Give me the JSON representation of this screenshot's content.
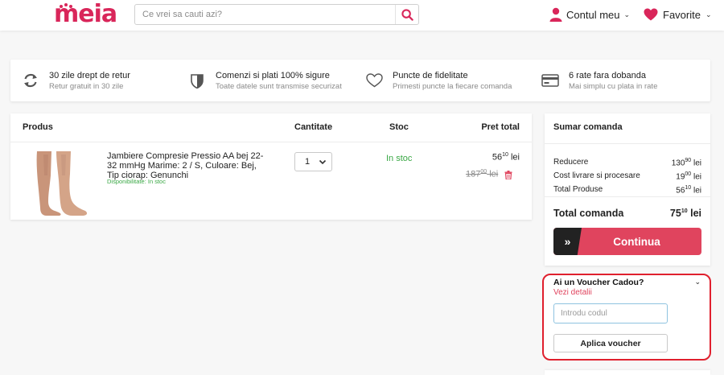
{
  "header": {
    "logo": "meia",
    "search_placeholder": "Ce vrei sa cauti azi?",
    "account_label": "Contul meu",
    "favorites_label": "Favorite"
  },
  "features": [
    {
      "icon": "refresh-icon",
      "title": "30 zile drept de retur",
      "subtitle": "Retur gratuit in 30 zile"
    },
    {
      "icon": "shield-icon",
      "title": "Comenzi si plati 100% sigure",
      "subtitle": "Toate datele sunt transmise securizat"
    },
    {
      "icon": "heart-outline-icon",
      "title": "Puncte de fidelitate",
      "subtitle": "Primesti puncte la fiecare comanda"
    },
    {
      "icon": "credit-card-icon",
      "title": "6 rate fara dobanda",
      "subtitle": "Mai simplu cu plata in rate"
    }
  ],
  "cart": {
    "headers": {
      "product": "Produs",
      "quantity": "Cantitate",
      "stock": "Stoc",
      "total": "Pret total"
    },
    "item": {
      "name": "Jambiere Compresie Pressio AA bej 22-32 mmHg Marime: 2 / S, Culoare: Bej, Tip ciorap: Genunchi",
      "availability": "Disponibilitate: In stoc",
      "quantity": "1",
      "stock": "In stoc",
      "price_int": "56",
      "price_dec": "10",
      "old_price_int": "187",
      "old_price_dec": "00",
      "currency": "lei"
    }
  },
  "summary": {
    "title": "Sumar comanda",
    "rows": [
      {
        "label": "Reducere",
        "int": "130",
        "dec": "90",
        "currency": "lei"
      },
      {
        "label": "Cost livrare si procesare",
        "int": "19",
        "dec": "00",
        "currency": "lei"
      },
      {
        "label": "Total Produse",
        "int": "56",
        "dec": "10",
        "currency": "lei"
      }
    ],
    "total_label": "Total comanda",
    "total_int": "75",
    "total_dec": "10",
    "total_currency": "lei",
    "continue_label": "Continua",
    "continue_arrow": "»"
  },
  "voucher": {
    "title": "Ai un Voucher Cadou?",
    "details_link": "Vezi detalii",
    "input_placeholder": "Introdu codul",
    "apply_label": "Aplica voucher"
  },
  "colors": {
    "brand": "#d9265a",
    "accent": "#e0445e",
    "in_stock": "#3aa845",
    "voucher_border": "#e0202e"
  }
}
